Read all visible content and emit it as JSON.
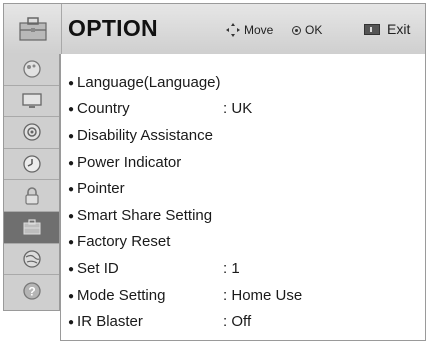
{
  "header": {
    "title": "OPTION",
    "move_label": "Move",
    "ok_label": "OK",
    "exit_label": "Exit",
    "icon": "option-toolbox-icon"
  },
  "sidebar": {
    "items": [
      {
        "name": "picture",
        "icon": "picture-settings-icon"
      },
      {
        "name": "screen",
        "icon": "screen-icon"
      },
      {
        "name": "audio",
        "icon": "speaker-icon"
      },
      {
        "name": "time",
        "icon": "clock-icon"
      },
      {
        "name": "lock",
        "icon": "lock-icon"
      },
      {
        "name": "option",
        "icon": "option-toolbox-icon",
        "active": true
      },
      {
        "name": "network",
        "icon": "globe-icon"
      },
      {
        "name": "support",
        "icon": "help-icon"
      }
    ]
  },
  "menu": {
    "items": [
      {
        "label": "Language(Language)",
        "value": ""
      },
      {
        "label": "Country",
        "value": ": UK"
      },
      {
        "label": "Disability Assistance",
        "value": ""
      },
      {
        "label": "Power Indicator",
        "value": ""
      },
      {
        "label": "Pointer",
        "value": ""
      },
      {
        "label": "Smart Share Setting",
        "value": ""
      },
      {
        "label": "Factory Reset",
        "value": ""
      },
      {
        "label": "Set ID",
        "value": ": 1"
      },
      {
        "label": "Mode Setting",
        "value": ": Home Use"
      },
      {
        "label": "IR Blaster",
        "value": ": Off"
      }
    ]
  }
}
